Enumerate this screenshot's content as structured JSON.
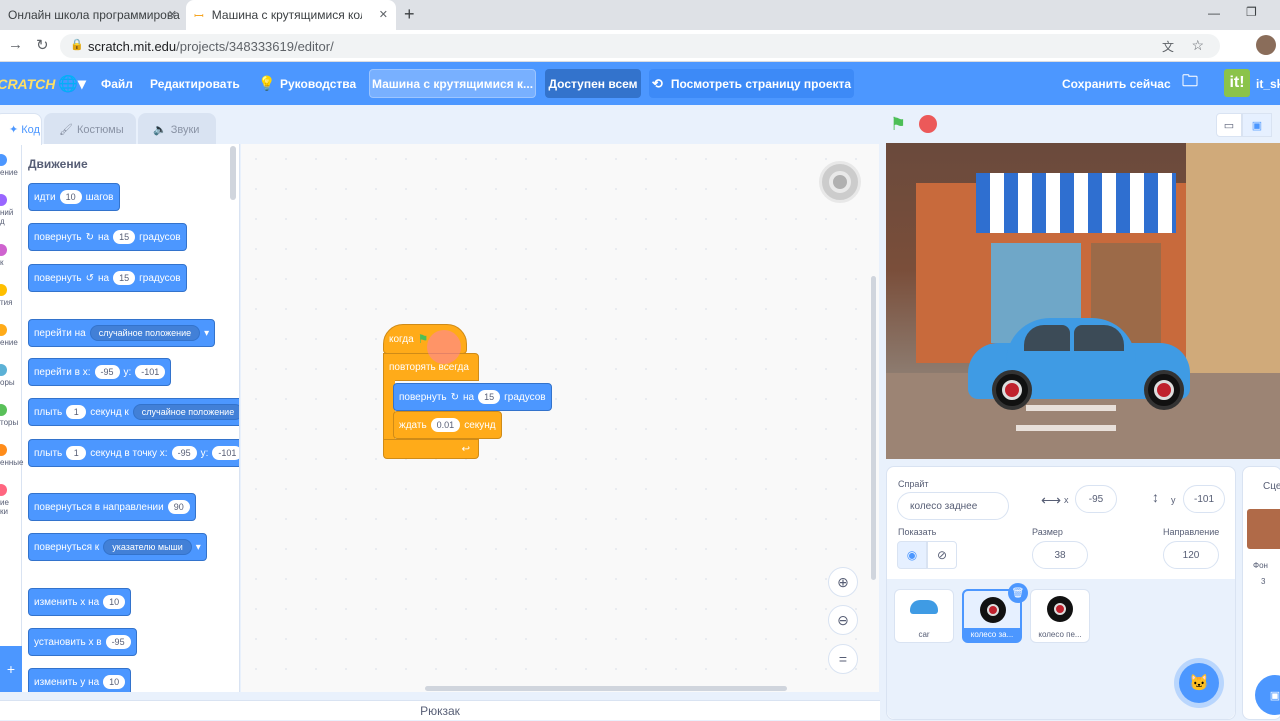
{
  "browser": {
    "tabs": [
      {
        "title": "Онлайн школа программирова"
      },
      {
        "title": "Машина с крутящимися колеса"
      }
    ],
    "url_host": "scratch.mit.edu",
    "url_path": "/projects/348333619/editor/",
    "new_tab": "+"
  },
  "menu": {
    "logo": "SCRATCH",
    "file": "Файл",
    "edit": "Редактировать",
    "tutorials": "Руководства",
    "project_title": "Машина с крутящимися к...",
    "share": "Доступен всем",
    "see_project_page": "Посмотреть страницу проекта",
    "save_now": "Сохранить сейчас",
    "user": "it_sk"
  },
  "editor_tabs": {
    "code": "Код",
    "costumes": "Костюмы",
    "sounds": "Звуки"
  },
  "categories": [
    {
      "label": "ение",
      "color": "#4c97ff"
    },
    {
      "label": "ний\nд",
      "color": "#9966ff"
    },
    {
      "label": "к",
      "color": "#cf63cf"
    },
    {
      "label": "тия",
      "color": "#ffbf00"
    },
    {
      "label": "ение",
      "color": "#ffab19"
    },
    {
      "label": "оры",
      "color": "#5cb1d6"
    },
    {
      "label": "торы",
      "color": "#59c059"
    },
    {
      "label": "енные",
      "color": "#ff8c1a"
    },
    {
      "label": "ие\nки",
      "color": "#ff6680"
    }
  ],
  "palette": {
    "heading": "Движение",
    "blocks": {
      "move": {
        "a": "идти",
        "v": "10",
        "b": "шагов"
      },
      "turn_right": {
        "a": "повернуть",
        "b": "на",
        "v": "15",
        "c": "градусов"
      },
      "turn_left": {
        "a": "повернуть",
        "b": "на",
        "v": "15",
        "c": "градусов"
      },
      "goto": {
        "a": "перейти на",
        "d": "случайное положение"
      },
      "goto_xy": {
        "a": "перейти в x:",
        "x": "-95",
        "b": "y:",
        "y": "-101"
      },
      "glide": {
        "a": "плыть",
        "v": "1",
        "b": "секунд к",
        "d": "случайное положение"
      },
      "glide_xy": {
        "a": "плыть",
        "v": "1",
        "b": "секунд в точку x:",
        "x": "-95",
        "c": "y:",
        "y": "-101"
      },
      "point_dir": {
        "a": "повернуться в направлении",
        "v": "90"
      },
      "point_towards": {
        "a": "повернуться к",
        "d": "указателю мыши"
      },
      "change_x": {
        "a": "изменить x на",
        "v": "10"
      },
      "set_x": {
        "a": "установить x в",
        "v": "-95"
      },
      "change_y": {
        "a": "изменить y на",
        "v": "10"
      }
    }
  },
  "script": {
    "hat": "когда",
    "forever": "повторять всегда",
    "turn": {
      "a": "повернуть",
      "b": "на",
      "v": "15",
      "c": "градусов"
    },
    "wait": {
      "a": "ждать",
      "v": "0.01",
      "b": "секунд"
    }
  },
  "backpack": "Рюкзак",
  "sprite_info": {
    "sprite_label": "Спрайт",
    "sprite_name": "колесо заднее",
    "x_label": "x",
    "x": "-95",
    "y_label": "y",
    "y": "-101",
    "show_label": "Показать",
    "size_label": "Размер",
    "size": "38",
    "direction_label": "Направление",
    "direction": "120"
  },
  "sprites": [
    {
      "name": "car"
    },
    {
      "name": "колесо за..."
    },
    {
      "name": "колесо пе..."
    }
  ],
  "stage_pane": {
    "label": "Сцен",
    "backdrops_label": "Фон",
    "backdrops_count": "3"
  },
  "colors": {
    "motion": "#4c97ff",
    "control": "#ffab19",
    "menubar": "#4c97ff"
  }
}
